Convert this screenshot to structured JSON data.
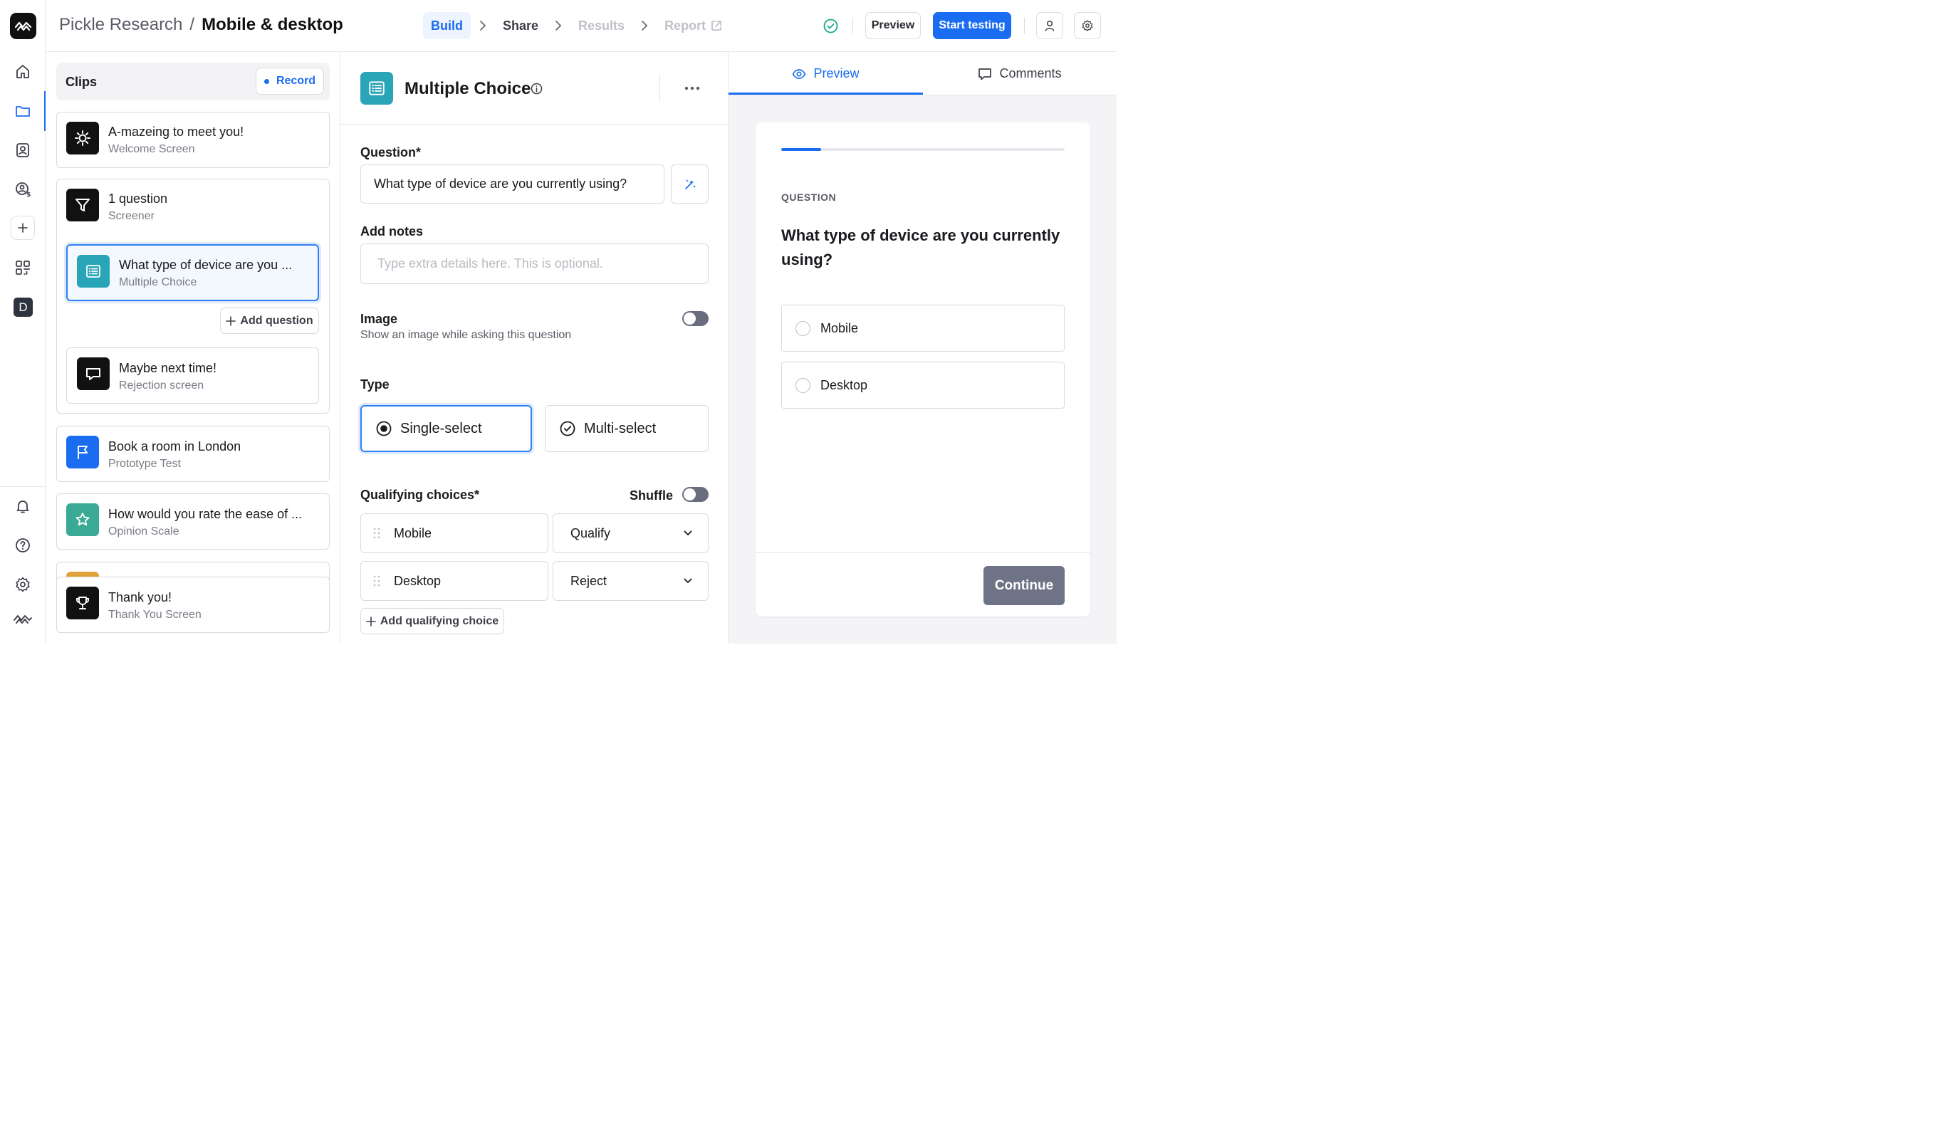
{
  "header": {
    "project": "Pickle Research",
    "separator": "/",
    "study": "Mobile & desktop",
    "steps": [
      {
        "label": "Build",
        "state": "active"
      },
      {
        "label": "Share",
        "state": "normal"
      },
      {
        "label": "Results",
        "state": "disabled"
      },
      {
        "label": "Report",
        "state": "disabled"
      }
    ],
    "preview_label": "Preview",
    "start_label": "Start testing"
  },
  "rail": {
    "avatar_letter": "D"
  },
  "clips": {
    "title": "Clips",
    "record_label": "Record",
    "add_question_label": "Add question",
    "items": [
      {
        "title": "A-mazeing to meet you!",
        "subtitle": "Welcome Screen",
        "icon": "sun-icon"
      },
      {
        "title": "1 question",
        "subtitle": "Screener",
        "icon": "filter-icon"
      },
      {
        "title": "What type of device are you ...",
        "subtitle": "Multiple Choice",
        "icon": "list-icon"
      },
      {
        "title": "Maybe next time!",
        "subtitle": "Rejection screen",
        "icon": "chat-icon"
      },
      {
        "title": "Book a room in London",
        "subtitle": "Prototype Test",
        "icon": "flag-icon"
      },
      {
        "title": "How would you rate the ease of ...",
        "subtitle": "Opinion Scale",
        "icon": "star-icon"
      },
      {
        "title": "Thank you!",
        "subtitle": "Thank You Screen",
        "icon": "trophy-icon"
      }
    ]
  },
  "editor": {
    "block_title": "Multiple Choice",
    "question_label": "Question*",
    "question_value": "What type of device are you currently using?",
    "notes_label": "Add notes",
    "notes_placeholder": "Type extra details here. This is optional.",
    "image_label": "Image",
    "image_desc": "Show an image while asking this question",
    "type_label": "Type",
    "type_single": "Single-select",
    "type_multi": "Multi-select",
    "choices_label": "Qualifying choices*",
    "shuffle_label": "Shuffle",
    "choices": [
      {
        "label": "Mobile",
        "action": "Qualify"
      },
      {
        "label": "Desktop",
        "action": "Reject"
      }
    ],
    "add_choice_label": "Add qualifying choice"
  },
  "preview": {
    "tab_preview": "Preview",
    "tab_comments": "Comments",
    "progress": 0.14,
    "kicker": "QUESTION",
    "question": "What type of device are you currently using?",
    "options": [
      "Mobile",
      "Desktop"
    ],
    "continue_label": "Continue"
  },
  "colors": {
    "accent": "#1a6cf0",
    "teal": "#2aa5b8",
    "continue_bg": "#6f7386"
  }
}
